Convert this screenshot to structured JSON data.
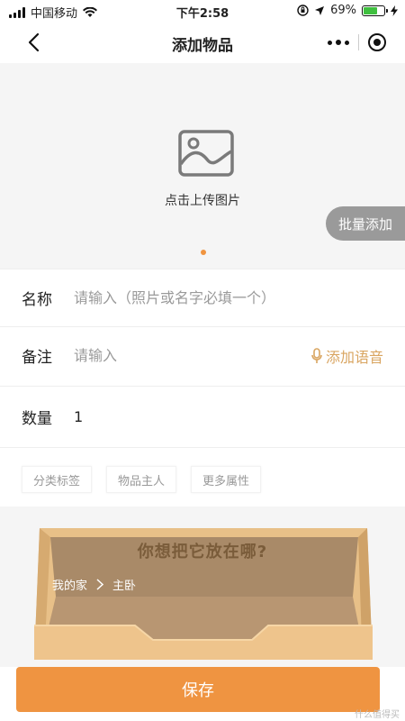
{
  "status_bar": {
    "carrier": "中国移动",
    "time": "下午2:58",
    "battery_percent_text": "69%",
    "battery_level": 0.69
  },
  "nav": {
    "title": "添加物品"
  },
  "upload": {
    "label": "点击上传图片",
    "batch_add_label": "批量添加"
  },
  "form": {
    "name_label": "名称",
    "name_placeholder": "请输入（照片或名字必填一个）",
    "note_label": "备注",
    "note_placeholder": "请输入",
    "voice_label": "添加语音",
    "quantity_label": "数量",
    "quantity_value": "1"
  },
  "tags": [
    "分类标签",
    "物品主人",
    "更多属性"
  ],
  "location": {
    "question": "你想把它放在哪?",
    "path_root": "我的家",
    "path_room": "主卧"
  },
  "save_label": "保存",
  "watermark": "什么值得买",
  "colors": {
    "accent_orange": "#ef9441",
    "voice_gold": "#d9a561",
    "box_wood": "#e3b77a"
  },
  "icons": {
    "back": "chevron-left-icon",
    "more": "more-dots-icon",
    "target": "target-icon",
    "image": "image-icon",
    "mic": "microphone-icon",
    "path_separator": "chevron-right-icon"
  }
}
